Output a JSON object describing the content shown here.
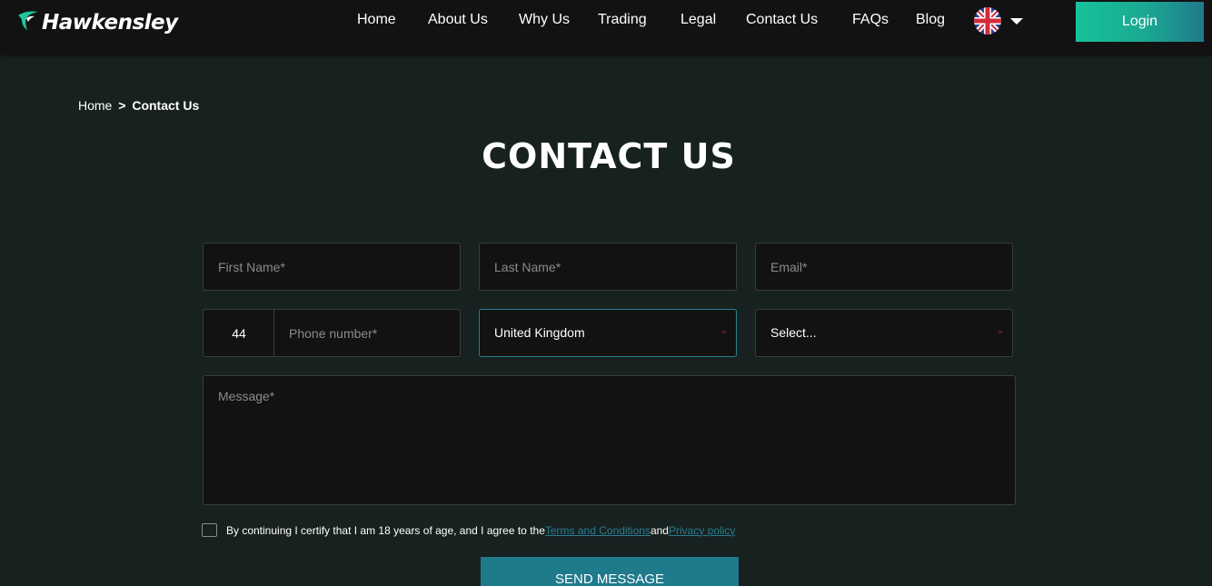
{
  "brand": {
    "name": "Hawkensley"
  },
  "nav": {
    "items": [
      "Home",
      "About Us",
      "Why Us",
      "Trading",
      "Legal",
      "Contact Us",
      "FAQs",
      "Blog"
    ],
    "language_icon": "uk-flag-icon",
    "login_label": "Login"
  },
  "breadcrumb": {
    "home": "Home",
    "separator": ">",
    "current": "Contact Us"
  },
  "page_title": "CONTACT US",
  "form": {
    "first_name_placeholder": "First Name*",
    "last_name_placeholder": "Last Name*",
    "email_placeholder": "Email*",
    "phone_code": "44",
    "phone_placeholder": "Phone number*",
    "country_value": "United Kingdom",
    "select_value": "Select...",
    "message_placeholder": "Message*",
    "consent_text": "By continuing I certify that I am 18 years of age, and I agree to the ",
    "terms_link": "Terms and Conditions ",
    "consent_and": "and ",
    "privacy_link": "Privacy policy",
    "submit_label": "SEND MESSAGE"
  },
  "colors": {
    "background": "#17211f",
    "header": "#121212",
    "accent": "#1f7a8c",
    "login_gradient_start": "#17c29a"
  }
}
